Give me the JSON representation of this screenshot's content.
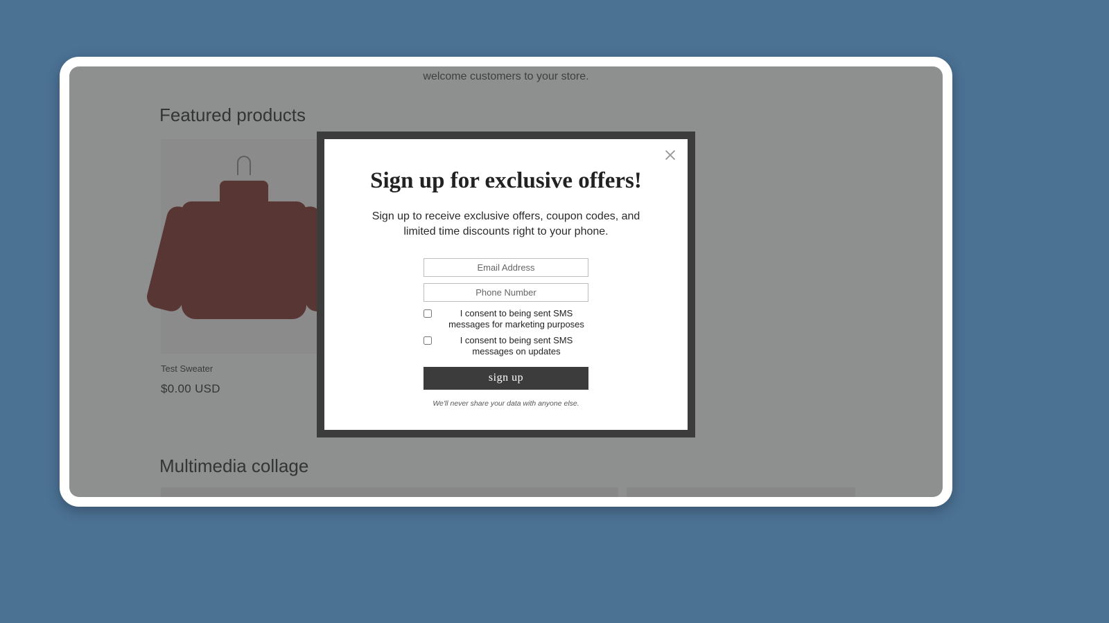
{
  "page": {
    "welcome_fragment": "welcome customers to your store.",
    "featured_heading": "Featured products",
    "collage_heading": "Multimedia collage"
  },
  "product": {
    "name": "Test Sweater",
    "price": "$0.00 USD"
  },
  "modal": {
    "title": "Sign up for exclusive offers!",
    "subtitle": "Sign up to receive exclusive offers, coupon codes, and limited time discounts right to your phone.",
    "email_placeholder": "Email Address",
    "phone_placeholder": "Phone Number",
    "consent_marketing": "I consent to being sent SMS messages for marketing purposes",
    "consent_updates": "I consent to being sent SMS messages on updates",
    "signup_label": "sign up",
    "privacy_note": "We'll never share your data with anyone else."
  }
}
